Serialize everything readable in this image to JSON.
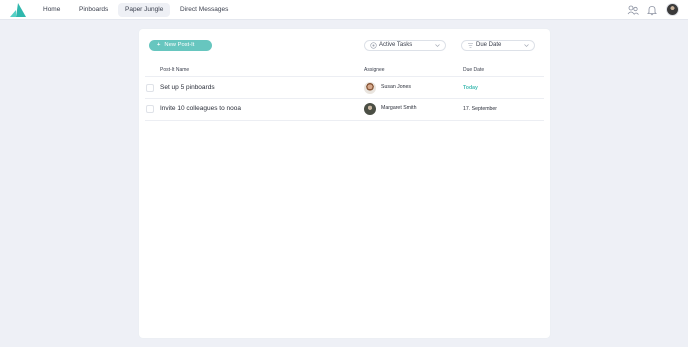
{
  "nav": {
    "items": [
      {
        "label": "Home"
      },
      {
        "label": "Pinboards"
      },
      {
        "label": "Paper Jungle"
      },
      {
        "label": "Direct Messages"
      }
    ],
    "active_index": 2
  },
  "toolbar": {
    "new_label": "New Post-It",
    "filter_value": "Active Tasks",
    "sort_value": "Due Date"
  },
  "table": {
    "columns": [
      "Post-It Name",
      "Assignee",
      "Due Date"
    ],
    "rows": [
      {
        "name": "Set up 5 pinboards",
        "assignee": "Susan Jones",
        "due": "Today"
      },
      {
        "name": "Invite 10 colleagues to nooa",
        "assignee": "Margaret Smith",
        "due": "17. September"
      }
    ]
  },
  "colors": {
    "accent": "#67c6bf",
    "today": "#46bdb4",
    "background": "#eef0f6"
  },
  "icons": [
    "logo-icon",
    "users-icon",
    "bell-icon",
    "avatar",
    "plus-icon",
    "filter-icon",
    "sort-icon",
    "chevron-down-icon"
  ]
}
